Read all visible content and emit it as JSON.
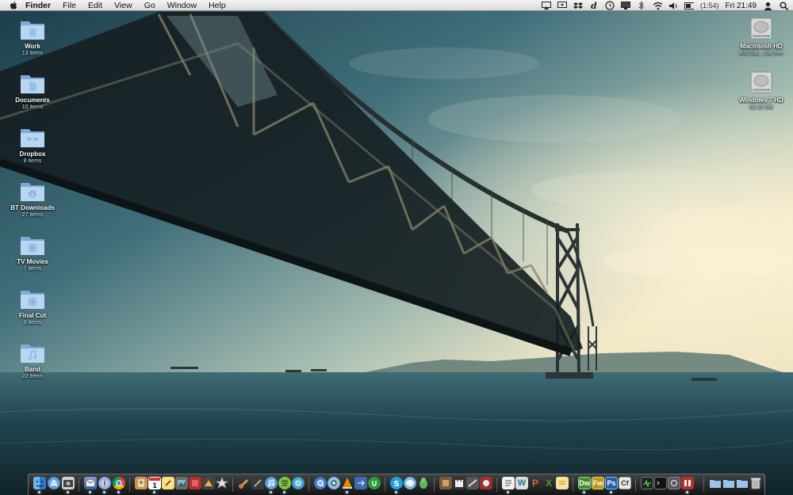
{
  "menubar": {
    "app_name": "Finder",
    "menus": [
      "File",
      "Edit",
      "View",
      "Go",
      "Window",
      "Help"
    ],
    "battery_text": "(1:54)",
    "clock": "Fri 21:49"
  },
  "desktop_left": [
    {
      "name": "Work",
      "sub": "13 items",
      "type": "folder"
    },
    {
      "name": "Documents",
      "sub": "10 items",
      "type": "folder"
    },
    {
      "name": "Dropbox",
      "sub": "8 items",
      "type": "folder"
    },
    {
      "name": "BT Downloads",
      "sub": "27 items",
      "type": "folder"
    },
    {
      "name": "TV Movies",
      "sub": "7 items",
      "type": "folder"
    },
    {
      "name": "Final Cut",
      "sub": "9 items",
      "type": "folder"
    },
    {
      "name": "Band",
      "sub": "22 items",
      "type": "folder"
    }
  ],
  "desktop_right": [
    {
      "name": "Macintosh HD",
      "sub": "439 GB,...GB free",
      "type": "drive"
    },
    {
      "name": "Windows 7 HD",
      "sub": "60.25 GB",
      "type": "drive"
    }
  ],
  "dock": {
    "text_icons": {
      "dreamweaver": "Dw",
      "fireworks": "Fw",
      "photoshop": "Ps",
      "coldfusion": "Cf",
      "wordpress": "W",
      "powerpoint": "P",
      "excel": "X"
    }
  },
  "colors": {
    "folder_light": "#b8d6f2",
    "folder_dark": "#7fa9d6",
    "dw": "#3e8f2c",
    "fw": "#b59a1a",
    "ps": "#1f5fa8",
    "cf": "#e9e9e9"
  }
}
